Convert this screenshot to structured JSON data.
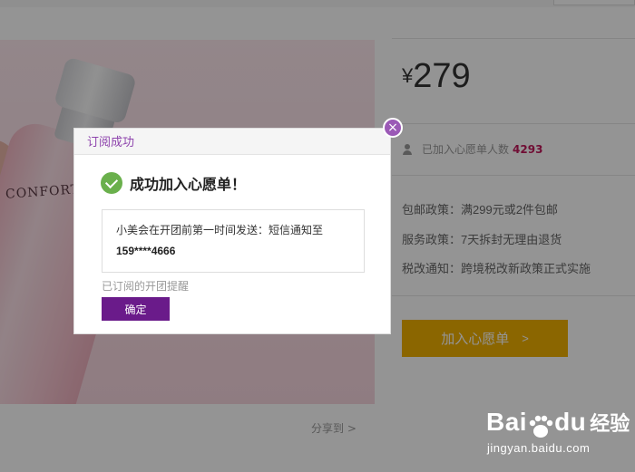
{
  "product": {
    "brand_on_bottle": "CONFORT",
    "price_symbol": "¥",
    "price": "279",
    "wish_count_label": "已加入心愿单人数",
    "wish_count": "4293",
    "policies": [
      "包邮政策：满299元或2件包邮",
      "服务政策：7天拆封无理由退货",
      "税改通知：跨境税改新政策正式实施"
    ],
    "add_wishlist_label": "加入心愿单",
    "add_wishlist_arrow": ">",
    "share_label": "分享到 >"
  },
  "modal": {
    "title": "订阅成功",
    "close_glyph": "×",
    "success_message": "成功加入心愿单！",
    "notice_line1": "小美会在开团前第一时间发送：短信通知至",
    "notice_phone": "159****4666",
    "subscribed_text": "已订阅的开团提醒",
    "confirm_label": "确定"
  },
  "watermark": {
    "logo_text": "Bai",
    "logo_text2": "du",
    "logo_suffix": "经验",
    "url": "jingyan.baidu.com"
  },
  "colors": {
    "accent_purple": "#8e44ad",
    "button_purple": "#6a1b8a",
    "wishlist_orange": "#f0b000",
    "success_green": "#6ab04c",
    "count_red": "#c2185b"
  }
}
